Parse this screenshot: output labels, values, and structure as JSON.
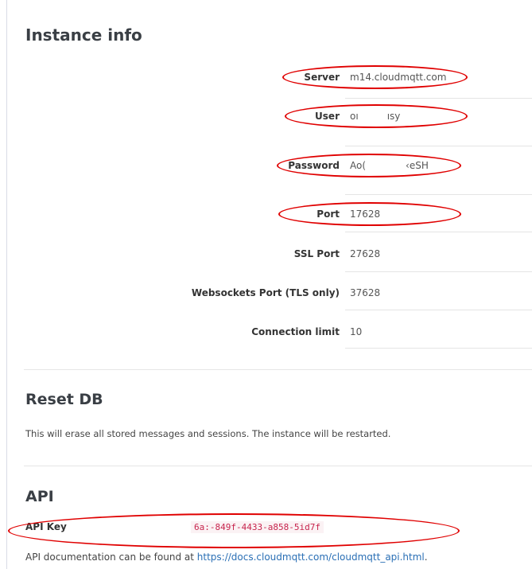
{
  "instance_info": {
    "title": "Instance info",
    "fields": [
      {
        "label": "Server",
        "value": "m14.cloudmqtt.com"
      },
      {
        "label": "User",
        "value_start": "oı",
        "value_end": "ısy"
      },
      {
        "label": "Password",
        "value_start": "Ao(",
        "value_end": "‹eSH"
      },
      {
        "label": "Port",
        "value": "17628"
      },
      {
        "label": "SSL Port",
        "value": "27628"
      },
      {
        "label": "Websockets Port (TLS only)",
        "value": "37628"
      },
      {
        "label": "Connection limit",
        "value": "10"
      }
    ]
  },
  "reset_db": {
    "title": "Reset DB",
    "description": "This will erase all stored messages and sessions. The instance will be restarted."
  },
  "api": {
    "title": "API",
    "key_label": "API Key",
    "key_start": "6a:",
    "key_middle": "-849f-4433-a858-5",
    "key_end": "id7f",
    "doc_prefix": "API documentation can be found at ",
    "doc_link": "https://docs.cloudmqtt.com/cloudmqtt_api.html",
    "doc_suffix": "."
  },
  "colors": {
    "annotation": "#e00000",
    "link": "#2a6fb5",
    "code": "#c7254e"
  }
}
